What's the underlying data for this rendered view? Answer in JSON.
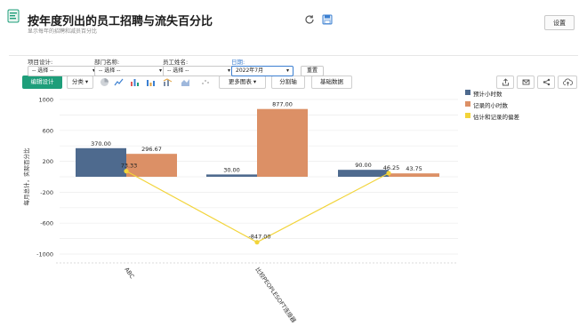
{
  "app": {
    "title": "按年度列出的员工招聘与流失百分比",
    "subtitle": "显示每年的招聘和减员百分比",
    "settings_label": "设置"
  },
  "toolbar": {
    "edit_label": "编辑设计",
    "group_label": "分类",
    "more_charts_label": "更多图表",
    "split_label": "分割轴",
    "base_data_label": "基础数据"
  },
  "filters": [
    {
      "label": "项目设计:",
      "value": "-- 选择 --"
    },
    {
      "label": "部门名称:",
      "value": "-- 选择 --"
    },
    {
      "label": "员工姓名:",
      "value": "-- 选择 --"
    },
    {
      "label": "日期:",
      "value": "2022年7月"
    }
  ],
  "reset_label": "重置",
  "colors": {
    "accent": "#1e9e7a",
    "series_blue": "#4e6a8e",
    "series_orange": "#dc9066",
    "series_yellow": "#f2d43a"
  },
  "chart_data": {
    "type": "bar",
    "ylabel": "每月总计，实际百分比",
    "ylim": [
      -1000,
      1000
    ],
    "yticks": [
      1000,
      600,
      200,
      -200,
      -600,
      -1000
    ],
    "categories": [
      "ABC",
      "比较PEOPLESOFT连接器",
      ""
    ],
    "series": [
      {
        "name": "预计小时数",
        "type": "bar",
        "color": "#4e6a8e",
        "values": [
          370.0,
          30.0,
          90.0
        ]
      },
      {
        "name": "记录的小时数",
        "type": "bar",
        "color": "#dc9066",
        "values": [
          296.67,
          877.0,
          43.75
        ]
      },
      {
        "name": "估计和记录的偏差",
        "type": "line",
        "color": "#f2d43a",
        "values": [
          73.33,
          -847.0,
          46.25
        ]
      }
    ],
    "data_labels": [
      [
        "370.00",
        "30.00",
        "90.00"
      ],
      [
        "296.67",
        "877.00",
        "43.75"
      ],
      [
        "73.33",
        "-847.00",
        "46.25"
      ]
    ],
    "grid": true,
    "legend": "top-right"
  }
}
